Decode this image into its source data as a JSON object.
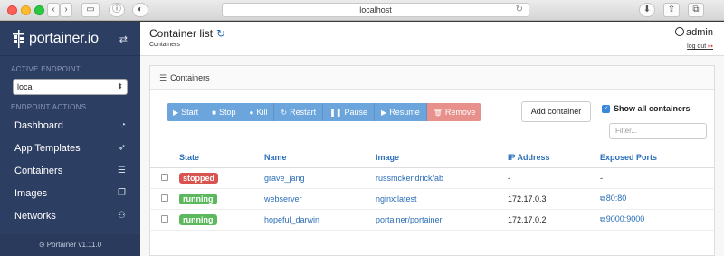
{
  "browser": {
    "url": "localhost",
    "nav_back": "‹",
    "nav_fwd": "›"
  },
  "sidebar": {
    "brand": "portainer.io",
    "active_endpoint_label": "ACTIVE ENDPOINT",
    "endpoint_value": "local",
    "endpoint_actions_label": "ENDPOINT ACTIONS",
    "items": [
      {
        "label": "Dashboard",
        "icon": "tachometer-icon",
        "glyph": "◔"
      },
      {
        "label": "App Templates",
        "icon": "rocket-icon",
        "glyph": "➶"
      },
      {
        "label": "Containers",
        "icon": "list-icon",
        "glyph": "☰"
      },
      {
        "label": "Images",
        "icon": "clone-icon",
        "glyph": "❐"
      },
      {
        "label": "Networks",
        "icon": "sitemap-icon",
        "glyph": "⚇"
      }
    ],
    "footer": "Portainer v1.11.0"
  },
  "header": {
    "title": "Container list",
    "breadcrumb": "Containers",
    "user": "admin",
    "logout": "log out"
  },
  "panel": {
    "title": "Containers"
  },
  "actions": {
    "start": "Start",
    "stop": "Stop",
    "kill": "Kill",
    "restart": "Restart",
    "pause": "Pause",
    "resume": "Resume",
    "remove": "Remove",
    "add": "Add container",
    "show_all": "Show all containers",
    "filter_placeholder": "Filter..."
  },
  "table": {
    "columns": [
      "State",
      "Name",
      "Image",
      "IP Address",
      "Exposed Ports"
    ],
    "rows": [
      {
        "state": "stopped",
        "name": "grave_jang",
        "image": "russmckendrick/ab",
        "ip": "-",
        "ports": "-"
      },
      {
        "state": "running",
        "name": "webserver",
        "image": "nginx:latest",
        "ip": "172.17.0.3",
        "ports": "80:80"
      },
      {
        "state": "running",
        "name": "hopeful_darwin",
        "image": "portainer/portainer",
        "ip": "172.17.0.2",
        "ports": "9000:9000"
      }
    ]
  },
  "colors": {
    "sidebar": "#2d3e63",
    "primary_button": "#6ca5dc",
    "danger_button": "#e8908b",
    "running": "#5cb85c",
    "stopped": "#d9534f",
    "link": "#2a6eb8"
  }
}
